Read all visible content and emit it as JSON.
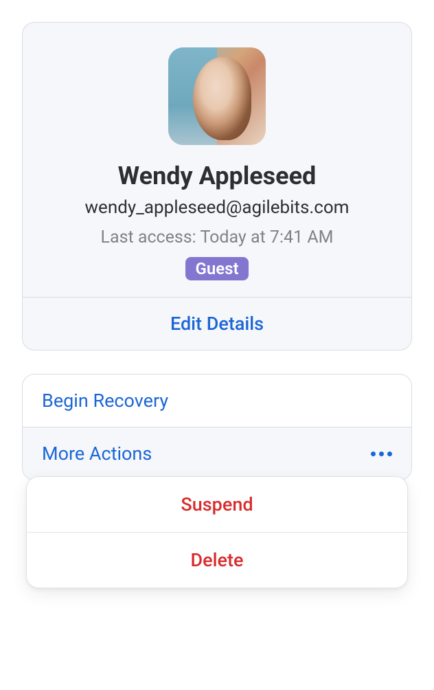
{
  "profile": {
    "name": "Wendy Appleseed",
    "email": "wendy_appleseed@agilebits.com",
    "last_access": "Last access: Today at 7:41 AM",
    "badge": "Guest",
    "edit_label": "Edit Details"
  },
  "actions": {
    "begin_recovery": "Begin Recovery",
    "more_actions": "More Actions"
  },
  "popup": {
    "suspend": "Suspend",
    "delete": "Delete"
  }
}
